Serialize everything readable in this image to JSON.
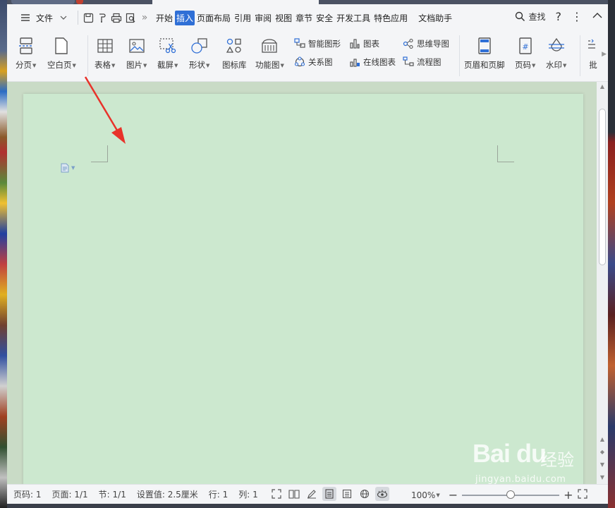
{
  "menubar": {
    "file_label": "文件",
    "tabs": [
      {
        "label": "开始",
        "active": false
      },
      {
        "label": "插入",
        "active": true
      },
      {
        "label": "页面布局",
        "active": false
      },
      {
        "label": "引用",
        "active": false
      },
      {
        "label": "审阅",
        "active": false
      },
      {
        "label": "视图",
        "active": false
      },
      {
        "label": "章节",
        "active": false
      },
      {
        "label": "安全",
        "active": false
      },
      {
        "label": "开发工具",
        "active": false
      },
      {
        "label": "特色应用",
        "active": false
      },
      {
        "label": "文档助手",
        "active": false
      }
    ],
    "more_label": "»",
    "find_label": "查找",
    "help_label": "?",
    "menu_label": "⋮",
    "collapse_label": "︿"
  },
  "ribbon": {
    "page_break": "分页",
    "blank_page": "空白页",
    "table": "表格",
    "picture": "图片",
    "screenshot": "截屏",
    "shape": "形状",
    "icon_library": "图标库",
    "function_chart": "功能图",
    "smart_art": "智能图形",
    "chart": "图表",
    "mind_map": "思维导图",
    "relation_chart": "关系图",
    "online_chart": "在线图表",
    "flowchart": "流程图",
    "header_footer": "页眉和页脚",
    "page_number": "页码",
    "watermark": "水印",
    "comment": "批"
  },
  "status": {
    "page_code": "页码: 1",
    "page": "页面: 1/1",
    "section": "节: 1/1",
    "setting": "设置值: 2.5厘米",
    "row": "行: 1",
    "col": "列: 1",
    "zoom": "100%",
    "zoom_level": 0.5
  },
  "watermark": {
    "brand": "Bai du",
    "cn": "经验",
    "url": "jingyan.baidu.com"
  },
  "colors": {
    "accent": "#2f6fd6",
    "page_bg": "#cce8cf",
    "arrow": "#e8322a"
  }
}
